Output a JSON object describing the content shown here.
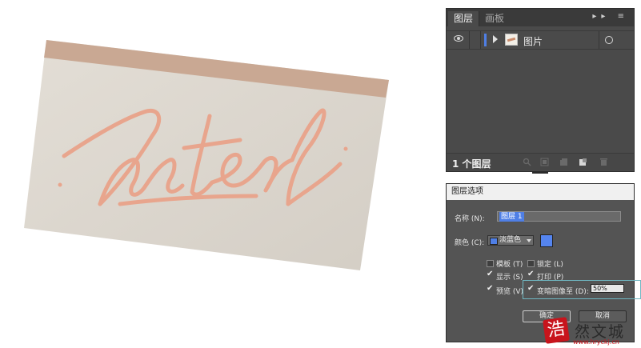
{
  "layers_panel": {
    "tabs": [
      "图层",
      "画板"
    ],
    "menu_icons": "▸▸ ≡",
    "layer": {
      "name": "图片",
      "color": "#4f7fe6"
    },
    "footer": {
      "count_label": "1 个图层"
    }
  },
  "layer_options_dialog": {
    "title": "图层选项",
    "name_label": "名称 (N):",
    "name_value": "图层 1",
    "color_label": "颜色 (C):",
    "color_value": "淡蓝色",
    "color_hex": "#5585f0",
    "template_label": "模板 (T)",
    "lock_label": "锁定 (L)",
    "show_label": "显示 (S)",
    "print_label": "打印 (P)",
    "preview_label": "预览 (V)",
    "dim_label": "变暗图像至 (D):",
    "dim_value": "50%",
    "ok_label": "确定",
    "cancel_label": "取消"
  },
  "photo": {
    "handwriting": "Inter"
  },
  "watermark": {
    "badge": "浩",
    "brand": "然文城",
    "url": "www.hryckj.cn"
  },
  "colors": {
    "panel": "#4a4a4a",
    "accent": "#4f7fe6",
    "ink": "#e59a7e"
  }
}
